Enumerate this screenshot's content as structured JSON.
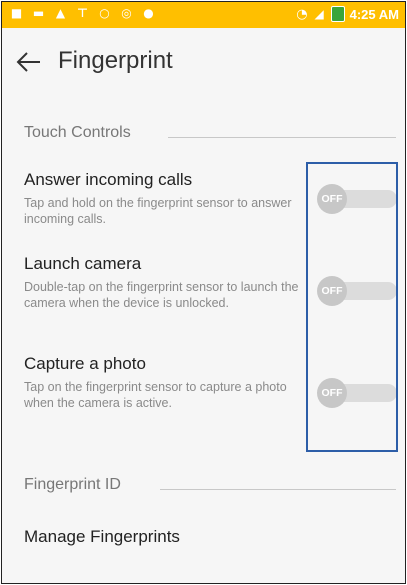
{
  "status_bar": {
    "time": "4:25 AM",
    "icons": [
      "notification-icon",
      "notification-icon",
      "alert-icon",
      "notification-icon",
      "notification-icon",
      "notification-icon",
      "notification-icon",
      "wifi-icon",
      "signal-icon",
      "battery-icon"
    ]
  },
  "app_bar": {
    "title": "Fingerprint"
  },
  "sections": {
    "touch_controls": "Touch Controls",
    "fingerprint_id": "Fingerprint ID"
  },
  "settings": [
    {
      "title": "Answer incoming calls",
      "description": "Tap and hold on the fingerprint sensor to answer incoming calls.",
      "state": "OFF"
    },
    {
      "title": "Launch camera",
      "description": "Double-tap on the fingerprint sensor to launch the camera when the device is unlocked.",
      "state": "OFF"
    },
    {
      "title": "Capture a photo",
      "description": "Tap on the fingerprint sensor to capture a photo when the camera is active.",
      "state": "OFF"
    }
  ],
  "manage": {
    "label": "Manage Fingerprints"
  },
  "colors": {
    "status_bar": "#ffbf00",
    "highlight": "#2d5ea8",
    "toggle_off": "#c7c7c7"
  }
}
